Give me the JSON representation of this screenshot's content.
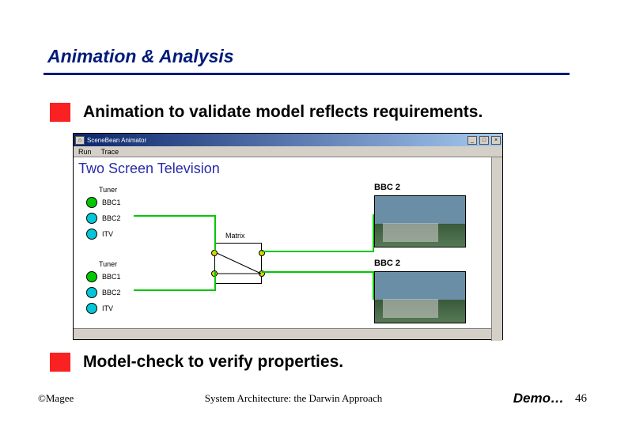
{
  "slide": {
    "title": "Animation & Analysis",
    "bullet1": "Animation to validate model reflects requirements.",
    "bullet2": "Model-check to verify properties."
  },
  "screenshot": {
    "window_title": "SceneBean Animator",
    "menus": [
      "Run",
      "Trace"
    ],
    "app_heading": "Two Screen Television",
    "tuner1_label": "Tuner",
    "tuner2_label": "Tuner",
    "matrix_label": "Matrix",
    "channels": [
      "BBC1",
      "BBC2",
      "ITV"
    ],
    "thumb1_caption": "BBC 2",
    "thumb2_caption": "BBC 2"
  },
  "footer": {
    "copyright": "©Magee",
    "center": "System Architecture: the Darwin Approach",
    "demo": "Demo…",
    "page": "46"
  }
}
